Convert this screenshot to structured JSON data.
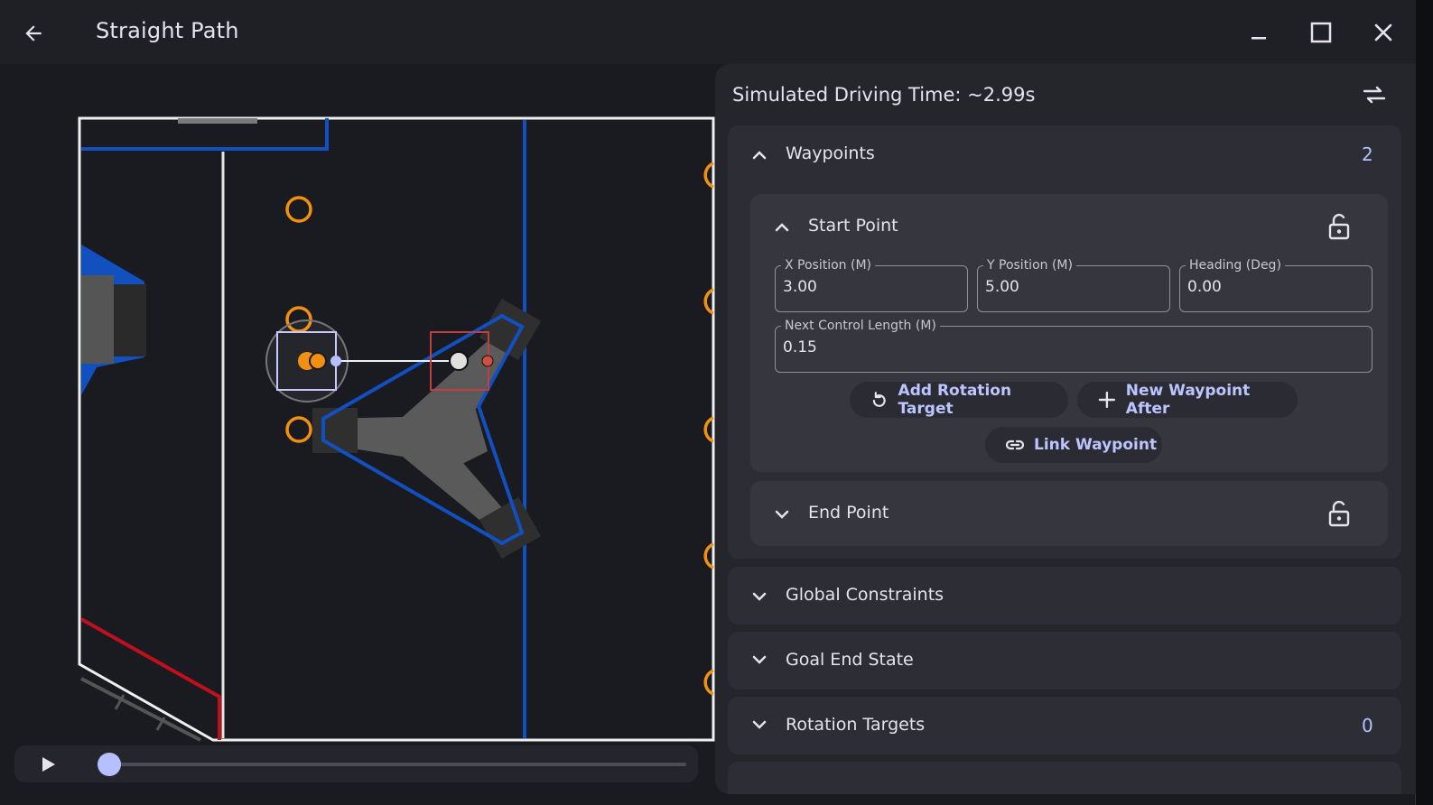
{
  "window": {
    "title": "Straight Path",
    "icons": {
      "back": "arrow-left-icon",
      "minimize": "minimize-icon",
      "maximize": "maximize-icon",
      "close": "close-icon"
    }
  },
  "playback": {
    "progress": 0.0,
    "icons": {
      "play": "play-icon"
    }
  },
  "sidebar": {
    "sim_time": "Simulated Driving Time: ~2.99s",
    "swap_icon": "swap-horizontal-icon",
    "waypoints": {
      "title": "Waypoints",
      "count": "2",
      "start_point": {
        "title": "Start Point",
        "x_label": "X Position (M)",
        "x_value": "3.00",
        "y_label": "Y Position (M)",
        "y_value": "5.00",
        "heading_label": "Heading (Deg)",
        "heading_value": "0.00",
        "control_label": "Next Control Length (M)",
        "control_value": "0.15",
        "add_rotation_label": "Add Rotation Target",
        "new_waypoint_label": "New Waypoint After",
        "link_waypoint_label": "Link Waypoint"
      },
      "end_point": {
        "title": "End Point"
      }
    },
    "global_constraints": {
      "title": "Global Constraints"
    },
    "goal_end_state": {
      "title": "Goal End State"
    },
    "rotation_targets": {
      "title": "Rotation Targets",
      "count": "0"
    }
  },
  "colors": {
    "accent": "#b7c0ff",
    "path_orange": "#f2900f",
    "field_blue": "#1250c0",
    "field_red": "#c0101e",
    "robot_box": "#c8c8ff",
    "control_red": "#d05040"
  }
}
